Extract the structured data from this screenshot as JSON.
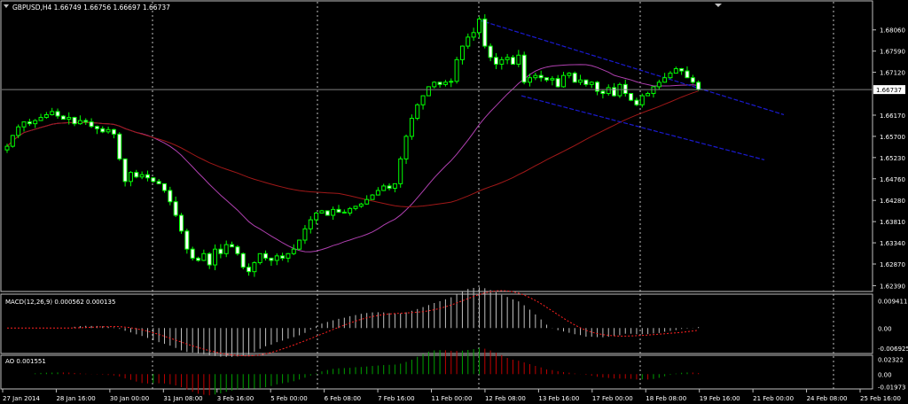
{
  "header": {
    "symbol_line": "GBPUSD,H4  1.66749 1.66756 1.66697 1.66737"
  },
  "colors": {
    "background": "#000000",
    "frame": "#c0c0c0",
    "text": "#ffffff",
    "grid": "#c0c0c0",
    "bull_candle": "#000000",
    "bull_border": "#00ff00",
    "bear_candle": "#ffffff",
    "bear_border": "#00ff00",
    "ma_fast": "#b040b0",
    "ma_slow": "#a01818",
    "channel": "#1a1ad0",
    "macd_hist": "#c0c0c0",
    "macd_signal": "#ff2020",
    "ao_up": "#00a000",
    "ao_down": "#c00000",
    "bid_line": "#808080",
    "current_price_box": "#ffffff"
  },
  "chart_data": [
    {
      "type": "candlestick",
      "title": "GBPUSD,H4",
      "ohlc_header": "1.66749 1.66756 1.66697 1.66737",
      "ylim": [
        1.6232,
        1.6833
      ],
      "y_ticks": [
        "1.68060",
        "1.67590",
        "1.67120",
        "1.66170",
        "1.65700",
        "1.65230",
        "1.64760",
        "1.64280",
        "1.63810",
        "1.63340",
        "1.62870",
        "1.62390"
      ],
      "current_price": "1.66737",
      "x_tick_labels": [
        "27 Jan 2014",
        "28 Jan 16:00",
        "30 Jan 00:00",
        "31 Jan 08:00",
        "3 Feb 16:00",
        "5 Feb 00:00",
        "6 Feb 08:00",
        "7 Feb 16:00",
        "11 Feb 00:00",
        "12 Feb 08:00",
        "13 Feb 16:00",
        "17 Feb 00:00",
        "18 Feb 08:00",
        "19 Feb 16:00",
        "21 Feb 00:00",
        "24 Feb 08:00",
        "25 Feb 16:00"
      ],
      "candles_close": [
        1.6548,
        1.6572,
        1.6591,
        1.6602,
        1.6598,
        1.6605,
        1.6612,
        1.6618,
        1.6625,
        1.6615,
        1.6608,
        1.6612,
        1.6598,
        1.6605,
        1.6602,
        1.6592,
        1.6587,
        1.658,
        1.6585,
        1.6575,
        1.652,
        1.647,
        1.649,
        1.648,
        1.6485,
        1.6478,
        1.647,
        1.6465,
        1.645,
        1.6425,
        1.6395,
        1.636,
        1.632,
        1.63,
        1.6295,
        1.631,
        1.6285,
        1.632,
        1.631,
        1.633,
        1.6325,
        1.631,
        1.628,
        1.627,
        1.629,
        1.631,
        1.63,
        1.6295,
        1.6305,
        1.63,
        1.631,
        1.632,
        1.634,
        1.6365,
        1.6385,
        1.64,
        1.6405,
        1.6395,
        1.6408,
        1.6402,
        1.64,
        1.641,
        1.6415,
        1.642,
        1.643,
        1.644,
        1.645,
        1.646,
        1.6455,
        1.6465,
        1.652,
        1.657,
        1.661,
        1.664,
        1.666,
        1.668,
        1.669,
        1.6685,
        1.669,
        1.6692,
        1.674,
        1.677,
        1.679,
        1.68,
        1.683,
        1.677,
        1.6745,
        1.673,
        1.674,
        1.6745,
        1.673,
        1.675,
        1.669,
        1.67,
        1.6705,
        1.67,
        1.6695,
        1.6698,
        1.668,
        1.6705,
        1.671,
        1.669,
        1.6695,
        1.6685,
        1.669,
        1.667,
        1.6665,
        1.6678,
        1.666,
        1.6685,
        1.6665,
        1.665,
        1.664,
        1.666,
        1.6665,
        1.668,
        1.669,
        1.67,
        1.671,
        1.672,
        1.6715,
        1.67,
        1.669,
        1.6674
      ]
    },
    {
      "type": "histogram",
      "title": "MACD(12,26,9) 0.000562 0.000135",
      "y_ticks": [
        "0.009411",
        "0.00",
        "-0.006925"
      ],
      "ylim": [
        -0.0085,
        0.0105
      ]
    },
    {
      "type": "histogram",
      "title": "AO 0.001551",
      "y_ticks": [
        "0.02322",
        "0.00",
        "-0.01973"
      ],
      "ylim": [
        -0.0215,
        0.025
      ]
    }
  ]
}
